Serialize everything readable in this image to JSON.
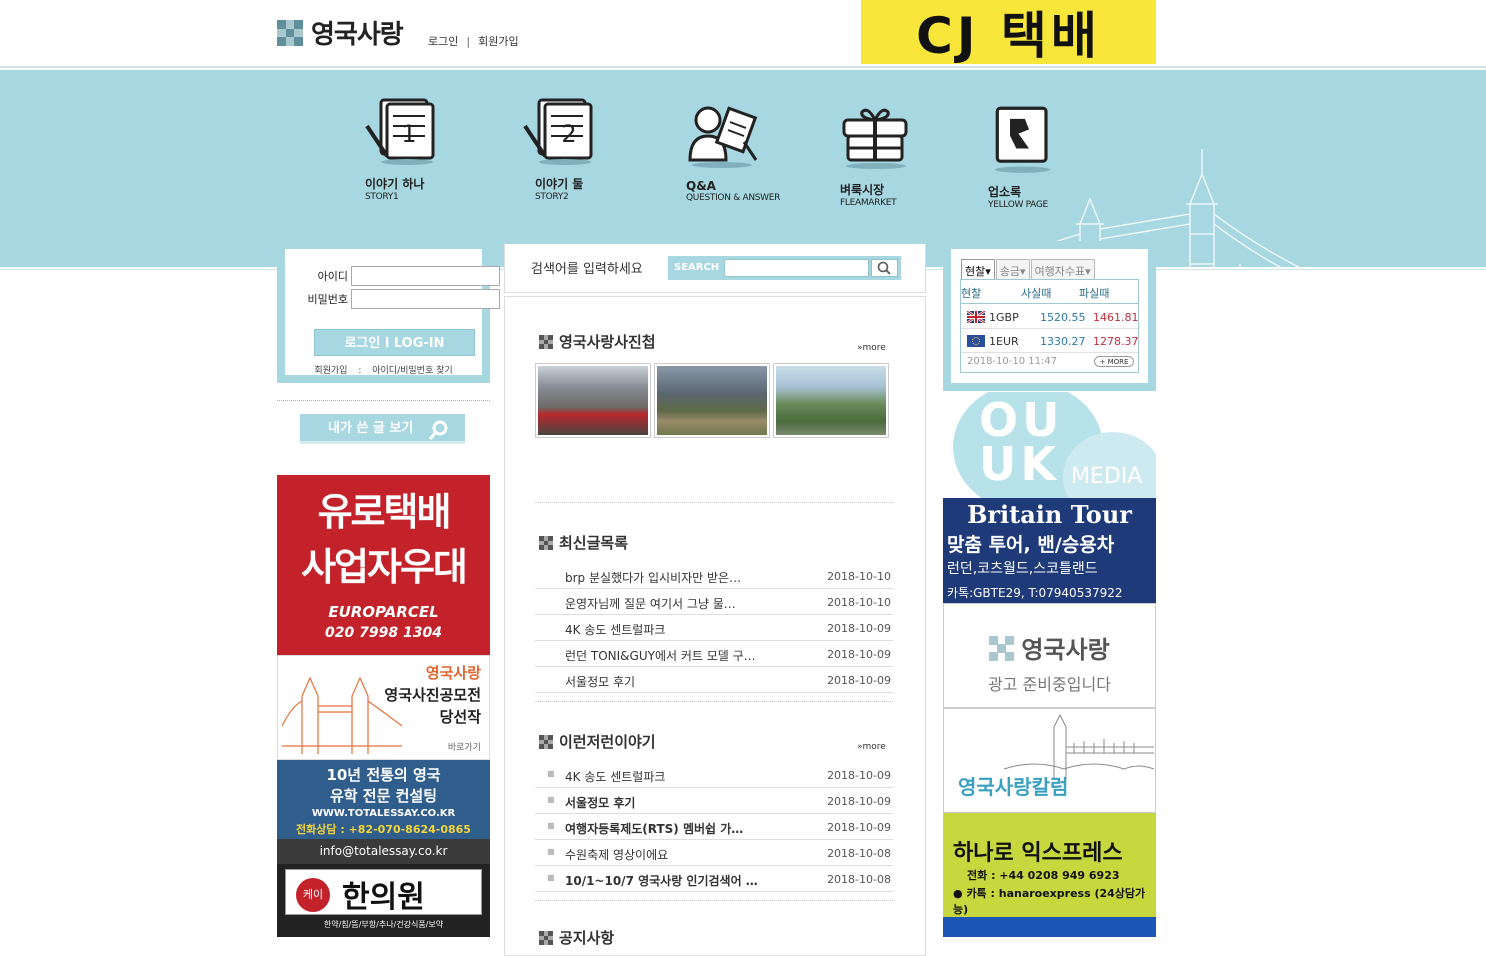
{
  "header": {
    "logo": "영국사랑",
    "login": "로그인",
    "separator": "|",
    "signup": "회원가입",
    "banner": "CJ 택배"
  },
  "nav": {
    "items": [
      {
        "title": "이야기 하나",
        "sub": "STORY1",
        "icon": "notepad-1-icon"
      },
      {
        "title": "이야기 둘",
        "sub": "STORY2",
        "icon": "notepad-2-icon"
      },
      {
        "title": "Q&A",
        "sub": "QUESTION & ANSWER",
        "icon": "person-question-icon"
      },
      {
        "title": "벼룩시장",
        "sub": "FLEAMARKET",
        "icon": "gift-box-icon"
      },
      {
        "title": "업소록",
        "sub": "YELLOW PAGE",
        "icon": "phonebook-icon"
      }
    ]
  },
  "login": {
    "id_label": "아이디",
    "pw_label": "비밀번호",
    "button": "로그인 l LOG-IN",
    "signup": "회원가입",
    "divider": ":",
    "find": "아이디/비밀번호 찾기",
    "my_posts": "내가 쓴 글 보기"
  },
  "left_ads": {
    "euro_title1": "유로택배",
    "euro_title2": "사업자우대",
    "euro_brand": "EUROPARCEL",
    "euro_phone": "020 7998 1304",
    "contest_brand": "영국사랑",
    "contest_line1": "영국사진공모전",
    "contest_line2": "당선작",
    "contest_link": "바로가기",
    "essay_line1": "10년 전통의 영국",
    "essay_line2": "유학 전문 컨설팅",
    "essay_site": "WWW.TOTALESSAY.CO.KR",
    "essay_phone": "전화상담 : +82-070-8624-0865",
    "essay_email": "info@totalessay.co.kr",
    "clinic_name": "한의원",
    "clinic_prefix": "케이",
    "clinic_desc": "한약/침/뜸/부항/추나/건강식품/보약"
  },
  "search": {
    "label": "검색어를 입력하세요",
    "tag": "SEARCH"
  },
  "sections": {
    "photo_title": "영국사랑사진첩",
    "recent_title": "최신글목록",
    "misc_title": "이런저런이야기",
    "notice_title": "공지사항",
    "more": "more"
  },
  "recent_posts": [
    {
      "title": "brp 분실했다가 입시비자만 받은…",
      "date": "2018-10-10"
    },
    {
      "title": "운영자님께 질문 여기서 그냥 물…",
      "date": "2018-10-10"
    },
    {
      "title": "4K 송도 센트럴파크",
      "date": "2018-10-09"
    },
    {
      "title": "런던 TONI&GUY에서 커트 모델 구…",
      "date": "2018-10-09"
    },
    {
      "title": "서울정모 후기",
      "date": "2018-10-09"
    }
  ],
  "misc_posts": [
    {
      "title": "4K 송도 센트럴파크",
      "date": "2018-10-09",
      "bold": false
    },
    {
      "title": "서울정모 후기",
      "date": "2018-10-09",
      "bold": true
    },
    {
      "title": "여행자등록제도(RTS) 멤버쉽 가…",
      "date": "2018-10-09",
      "bold": true
    },
    {
      "title": "수원축제 영상이에요",
      "date": "2018-10-08",
      "bold": false
    },
    {
      "title": "10/1~10/7 영국사랑 인기검색어 …",
      "date": "2018-10-08",
      "bold": true
    }
  ],
  "exchange": {
    "tabs": [
      "현찰",
      "송금",
      "여행자수표"
    ],
    "headers": [
      "현찰",
      "사실때",
      "파실때"
    ],
    "rows": [
      {
        "currency": "1GBP",
        "buy": "1520.55",
        "sell": "1461.81"
      },
      {
        "currency": "1EUR",
        "buy": "1330.27",
        "sell": "1278.37"
      }
    ],
    "date": "2018-10-10 11:47",
    "more": "+ MORE"
  },
  "right_ads": {
    "media_letters": "OUUK",
    "media_word": "MEDIA",
    "tour_title": "Britain Tour",
    "tour_line1": "맞춤 투어, 밴/승용차",
    "tour_line2": "런던,코츠월드,스코틀랜드",
    "tour_line3": "카톡:GBTE29, T:07940537922",
    "ad_brand": "영국사랑",
    "ad_text": "광고 준비중입니다",
    "column_title": "영국사랑칼럼",
    "hanaro_title": "하나로 익스프레스",
    "hanaro_phone": "전화 : +44 0208 949 6923",
    "hanaro_talk": "카톡 : hanaroexpress (24상담가능)"
  },
  "colors": {
    "accent": "#a7d7e1",
    "buy": "#2b7aa8",
    "sell": "#c0303a"
  }
}
